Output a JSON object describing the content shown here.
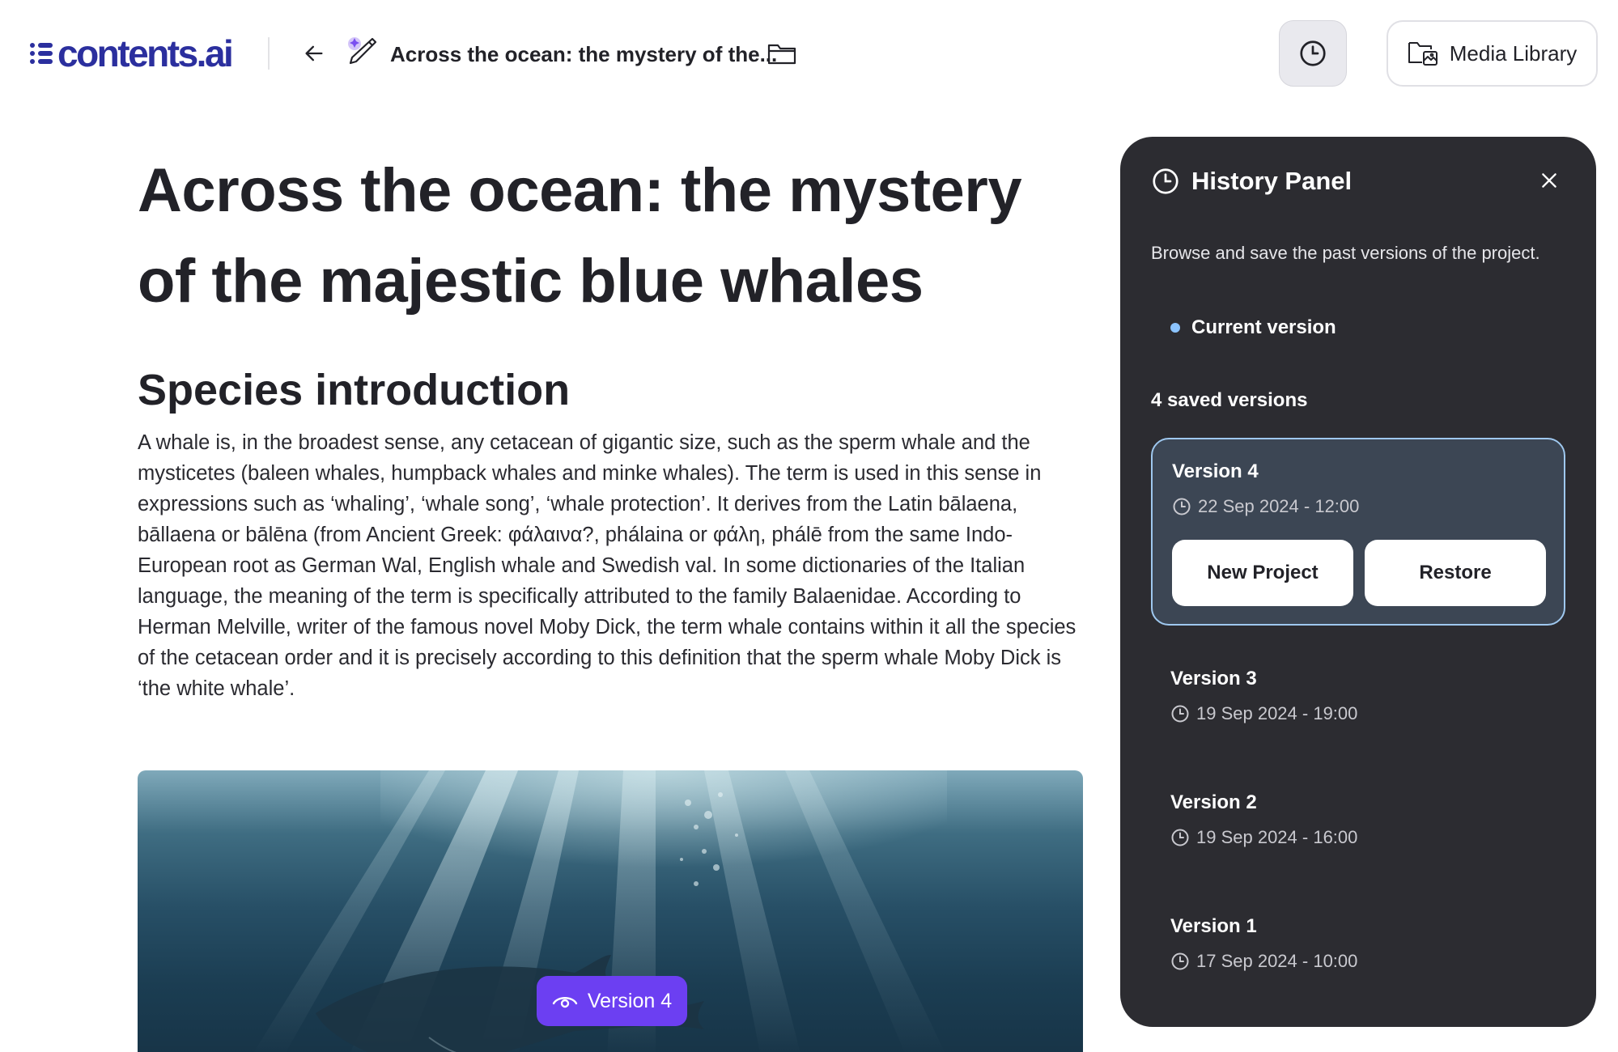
{
  "header": {
    "logo_text": "contents.ai",
    "document_title": "Across the ocean: the mystery of the...",
    "media_library_label": "Media Library"
  },
  "article": {
    "title": "Across the ocean: the mystery of the majestic blue whales",
    "section_heading": "Species introduction",
    "paragraph": "A whale is, in the broadest sense, any cetacean of gigantic size, such as the sperm whale and the mysticetes (baleen whales, humpback whales and minke whales). The term is used in this sense in expressions such as ‘whaling’, ‘whale song’, ‘whale protection’. It derives from the Latin bālaena, bāllaena or bālēna (from Ancient Greek: φάλαινα?, phálaina or φάλη, phálē from the same Indo-European root as German Wal, English whale and Swedish val. In some dictionaries of the Italian language, the meaning of the term is specifically attributed to the family Balaenidae. According to Herman Melville, writer of the famous novel Moby Dick, the term whale contains within it all the species of the cetacean order and it is precisely according to this definition that the sperm whale Moby Dick is ‘the white whale’.",
    "version_chip": "Version 4"
  },
  "history_panel": {
    "title": "History Panel",
    "description": "Browse and save the past versions of the project.",
    "current_version_label": "Current version",
    "saved_count_label": "4 saved versions",
    "versions": [
      {
        "name": "Version 4",
        "date": "22 Sep 2024 - 12:00"
      },
      {
        "name": "Version 3",
        "date": "19 Sep 2024 - 19:00"
      },
      {
        "name": "Version 2",
        "date": "19 Sep 2024 - 16:00"
      },
      {
        "name": "Version 1",
        "date": "17 Sep 2024 - 10:00"
      }
    ],
    "new_project_label": "New Project",
    "restore_label": "Restore"
  },
  "colors": {
    "brand": "#2b2f9e",
    "accent": "#6c3ff2",
    "panel_bg": "#2c2c31",
    "current_dot": "#8cc4ff"
  },
  "icons": [
    "back-arrow-icon",
    "pen-sparkle-icon",
    "folder-icon",
    "clock-icon",
    "media-library-icon",
    "close-icon",
    "eye-icon"
  ]
}
